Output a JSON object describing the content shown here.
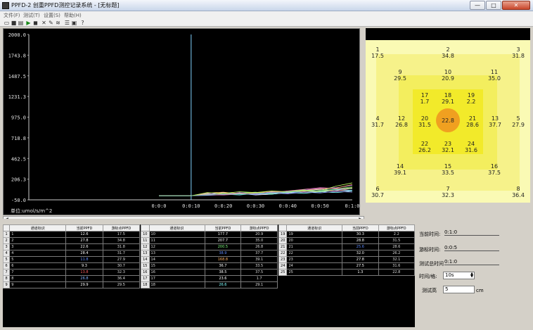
{
  "window": {
    "title": "PPFD-2 创重PPFD测控记录系统 - [无标题]",
    "min_label": "—",
    "max_label": "□",
    "close_label": "✕"
  },
  "menu": [
    "文件(F)",
    "测试(T)",
    "设置(S)",
    "帮助(H)"
  ],
  "toolbar": [
    "open-icon",
    "save-icon",
    "print-icon",
    "play-icon",
    "stop-icon",
    "tool-icon",
    "edit-icon",
    "chart-icon",
    "list-icon",
    "printer-icon",
    "help-icon"
  ],
  "chart_data": {
    "type": "line",
    "yticks": [
      "2000.0",
      "1743.8",
      "1487.5",
      "1231.3",
      "975.0",
      "718.8",
      "462.5",
      "206.3",
      "-50.0"
    ],
    "ylim": [
      -50,
      2000
    ],
    "xticks": [
      "0:0:0",
      "0:0:10",
      "0:0:20",
      "0:0:30",
      "0:0:40",
      "0:0:50",
      "0:1:0"
    ],
    "ylabel": "单位:umol/s/m^2",
    "cursor_x": "0:0:10",
    "grid": false,
    "colors": [
      "#ffffff",
      "#7fd0ff",
      "#ff8080",
      "#80ff80",
      "#ffff80",
      "#c080ff",
      "#80ffff",
      "#ffb060",
      "#a0a0ff",
      "#ff80c0",
      "#c0ff60",
      "#60c0a0",
      "#d0d0d0"
    ],
    "series_values": [
      [
        0,
        0,
        0,
        20,
        40,
        30,
        10,
        20,
        40,
        60,
        80,
        70,
        60
      ],
      [
        0,
        0,
        0,
        15,
        25,
        35,
        25,
        45,
        35,
        55,
        45,
        75,
        65
      ],
      [
        0,
        0,
        0,
        10,
        30,
        20,
        40,
        30,
        60,
        50,
        70,
        60,
        90
      ],
      [
        0,
        0,
        0,
        25,
        15,
        35,
        45,
        25,
        55,
        75,
        60,
        85,
        110
      ],
      [
        0,
        0,
        0,
        20,
        20,
        30,
        30,
        40,
        40,
        60,
        50,
        80,
        100
      ],
      [
        0,
        0,
        0,
        30,
        10,
        40,
        20,
        50,
        30,
        70,
        90,
        100,
        130
      ],
      [
        0,
        0,
        0,
        10,
        20,
        10,
        30,
        20,
        40,
        30,
        50,
        40,
        60
      ],
      [
        0,
        0,
        0,
        35,
        45,
        25,
        35,
        55,
        45,
        65,
        85,
        95,
        140
      ],
      [
        0,
        0,
        0,
        5,
        15,
        25,
        15,
        35,
        25,
        45,
        35,
        55,
        45
      ],
      [
        0,
        0,
        0,
        15,
        10,
        20,
        30,
        40,
        60,
        80,
        100,
        90,
        85
      ],
      [
        0,
        0,
        0,
        40,
        30,
        50,
        40,
        60,
        50,
        70,
        60,
        120,
        160
      ],
      [
        0,
        0,
        0,
        12,
        22,
        18,
        28,
        38,
        48,
        58,
        68,
        78,
        88
      ]
    ]
  },
  "heatmap": {
    "points": [
      {
        "n": "1",
        "v": "17.5"
      },
      {
        "n": "2",
        "v": "34.8"
      },
      {
        "n": "3",
        "v": "31.8"
      },
      {
        "n": "9",
        "v": "29.5"
      },
      {
        "n": "10",
        "v": "20.9"
      },
      {
        "n": "11",
        "v": "35.0"
      },
      {
        "n": "17",
        "v": "1.7"
      },
      {
        "n": "18",
        "v": "29.1"
      },
      {
        "n": "19",
        "v": "2.2"
      },
      {
        "n": "4",
        "v": "31.7"
      },
      {
        "n": "12",
        "v": "26.8"
      },
      {
        "n": "20",
        "v": "31.5"
      },
      {
        "n": "center",
        "v": "22.8"
      },
      {
        "n": "21",
        "v": "28.6"
      },
      {
        "n": "13",
        "v": "37.7"
      },
      {
        "n": "5",
        "v": "27.9"
      },
      {
        "n": "22",
        "v": "26.2"
      },
      {
        "n": "23",
        "v": "32.1"
      },
      {
        "n": "24",
        "v": "31.6"
      },
      {
        "n": "14",
        "v": "39.1"
      },
      {
        "n": "15",
        "v": "33.5"
      },
      {
        "n": "16",
        "v": "37.5"
      },
      {
        "n": "6",
        "v": "30.7"
      },
      {
        "n": "7",
        "v": "32.3"
      },
      {
        "n": "8",
        "v": "36.4"
      }
    ]
  },
  "table_headers": [
    "通道标识",
    "当前PPFD",
    "游标点PPFD"
  ],
  "tables": [
    {
      "rows": [
        {
          "rn": "1",
          "id": "1",
          "cur": "12.6",
          "cur_color": "#ffffff",
          "cursor": "17.5"
        },
        {
          "rn": "2",
          "id": "2",
          "cur": "27.8",
          "cur_color": "#ffffff",
          "cursor": "34.8"
        },
        {
          "rn": "3",
          "id": "3",
          "cur": "22.6",
          "cur_color": "#ffffff",
          "cursor": "31.8"
        },
        {
          "rn": "4",
          "id": "4",
          "cur": "28.4",
          "cur_color": "#ffffff",
          "cursor": "31.7"
        },
        {
          "rn": "5",
          "id": "5",
          "cur": "11.8",
          "cur_color": "#5f8cff",
          "cursor": "27.9"
        },
        {
          "rn": "6",
          "id": "6",
          "cur": "9.3",
          "cur_color": "#ffffff",
          "cursor": "30.7"
        },
        {
          "rn": "7",
          "id": "7",
          "cur": "13.8",
          "cur_color": "#ff6060",
          "cursor": "32.3"
        },
        {
          "rn": "8",
          "id": "8",
          "cur": "26.8",
          "cur_color": "#7fb0ff",
          "cursor": "36.4"
        },
        {
          "rn": "9",
          "id": "9",
          "cur": "29.9",
          "cur_color": "#ffffff",
          "cursor": "29.5"
        }
      ]
    },
    {
      "rows": [
        {
          "rn": "10",
          "id": "10",
          "cur": "177.7",
          "cur_color": "#ffffff",
          "cursor": "20.9"
        },
        {
          "rn": "11",
          "id": "11",
          "cur": "207.7",
          "cur_color": "#ffffff",
          "cursor": "35.0"
        },
        {
          "rn": "12",
          "id": "12",
          "cur": "200.5",
          "cur_color": "#80ff80",
          "cursor": "26.8"
        },
        {
          "rn": "13",
          "id": "13",
          "cur": "38.9",
          "cur_color": "#5f8cff",
          "cursor": "37.7"
        },
        {
          "rn": "14",
          "id": "14",
          "cur": "168.8",
          "cur_color": "#ffb060",
          "cursor": "39.1"
        },
        {
          "rn": "15",
          "id": "15",
          "cur": "36.7",
          "cur_color": "#ffffff",
          "cursor": "33.5"
        },
        {
          "rn": "16",
          "id": "16",
          "cur": "38.5",
          "cur_color": "#ffffff",
          "cursor": "37.5"
        },
        {
          "rn": "17",
          "id": "17",
          "cur": "23.6",
          "cur_color": "#ffffff",
          "cursor": "1.7"
        },
        {
          "rn": "18",
          "id": "18",
          "cur": "26.6",
          "cur_color": "#80ffff",
          "cursor": "29.1"
        }
      ]
    },
    {
      "rows": [
        {
          "rn": "19",
          "id": "19",
          "cur": "30.3",
          "cur_color": "#ffffff",
          "cursor": "2.2"
        },
        {
          "rn": "20",
          "id": "20",
          "cur": "28.8",
          "cur_color": "#ffffff",
          "cursor": "31.5"
        },
        {
          "rn": "21",
          "id": "21",
          "cur": "25.6",
          "cur_color": "#5f8cff",
          "cursor": "28.6"
        },
        {
          "rn": "22",
          "id": "22",
          "cur": "32.0",
          "cur_color": "#ffffff",
          "cursor": "26.2"
        },
        {
          "rn": "23",
          "id": "23",
          "cur": "27.8",
          "cur_color": "#ffffff",
          "cursor": "32.1"
        },
        {
          "rn": "24",
          "id": "24",
          "cur": "27.5",
          "cur_color": "#ffffff",
          "cursor": "31.6"
        },
        {
          "rn": "25",
          "id": "25",
          "cur": "1.3",
          "cur_color": "#ffffff",
          "cursor": "22.8"
        }
      ]
    }
  ],
  "side": {
    "current_time_label": "当前时间:",
    "current_time": "0:1:0",
    "cursor_time_label": "游标时间:",
    "cursor_time": "0:0:5",
    "total_time_label": "测试总时间",
    "total_time": "0:1:0",
    "interval_label": "时间/格:",
    "interval_value": "10s",
    "height_label": "测试高",
    "height_value": "5",
    "height_unit": "cm"
  }
}
